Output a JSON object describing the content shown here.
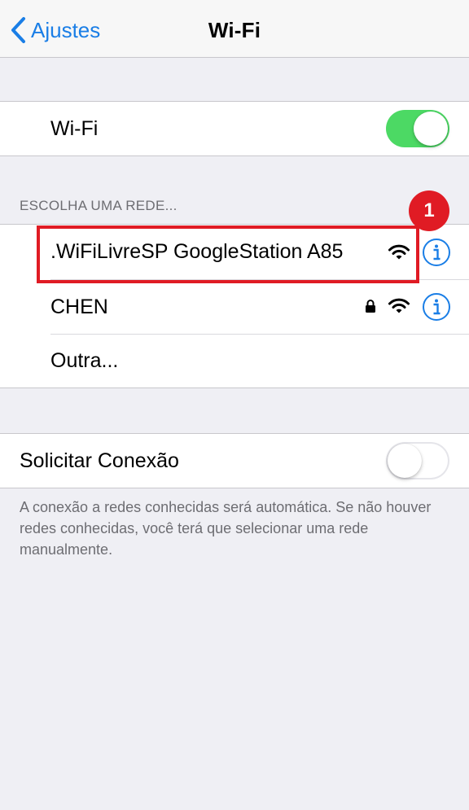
{
  "navbar": {
    "back_label": "Ajustes",
    "title": "Wi-Fi",
    "tint_color": "#1a7ee6"
  },
  "wifi_toggle": {
    "label": "Wi-Fi",
    "state": "on",
    "color": "#4cd964"
  },
  "networks": {
    "header": "ESCOLHA UMA REDE...",
    "items": [
      {
        "name": ".WiFiLivreSP GoogleStation A85",
        "secured": false,
        "icons": [
          "wifi-signal-icon",
          "info-icon"
        ]
      },
      {
        "name": "CHEN",
        "secured": true,
        "icons": [
          "lock-icon",
          "wifi-signal-icon",
          "info-icon"
        ]
      }
    ],
    "other_label": "Outra..."
  },
  "ask_to_join": {
    "label": "Solicitar Conexão",
    "state": "off",
    "footer": "A conexão a redes conhecidas será automática. Se não houver redes conhecidas, você terá que selecionar uma rede manualmente."
  },
  "annotation": {
    "badge_number": "1",
    "color": "#e01b24"
  }
}
